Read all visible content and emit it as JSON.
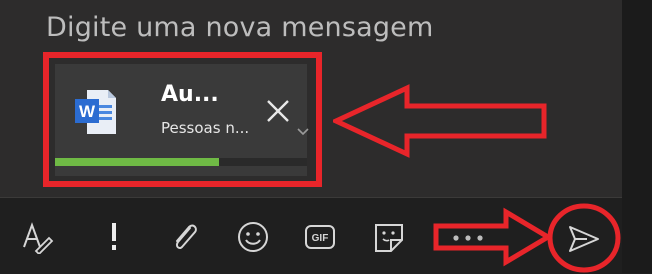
{
  "compose": {
    "placeholder": "Digite uma nova mensagem"
  },
  "attachment": {
    "name": "Au...",
    "subtitle": "Pessoas n...",
    "icon": "word-document-icon",
    "upload_progress_percent": 65
  },
  "toolbar": {
    "items": [
      {
        "name": "format-icon"
      },
      {
        "name": "important-icon"
      },
      {
        "name": "attach-icon"
      },
      {
        "name": "emoji-icon"
      },
      {
        "name": "gif-icon",
        "label": "GIF"
      },
      {
        "name": "sticker-icon"
      },
      {
        "name": "more-options-icon"
      },
      {
        "name": "send-icon"
      }
    ]
  },
  "colors": {
    "annotation": "#e8252a",
    "progress": "#6fba45",
    "word_blue": "#2b6cd1"
  }
}
